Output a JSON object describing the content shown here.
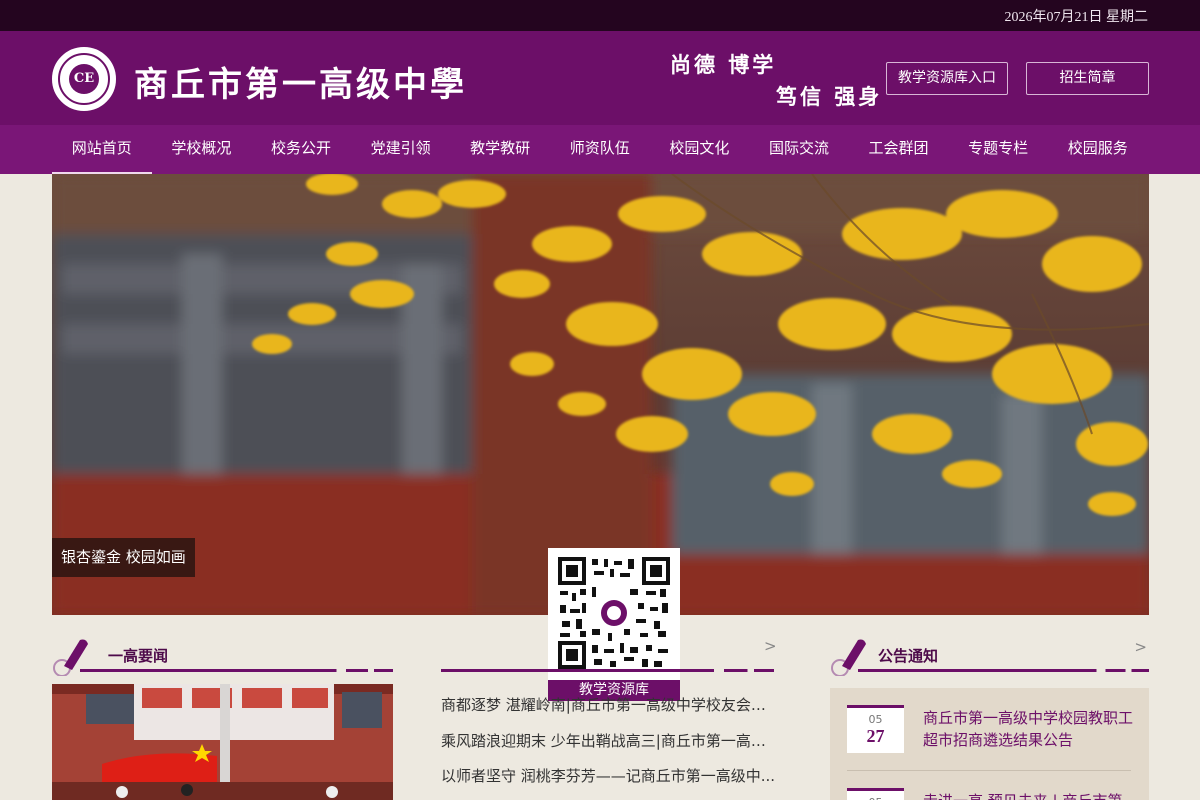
{
  "topbar": {
    "date": "2026年07月21日 星期二"
  },
  "header": {
    "school_name": "商丘市第一高级中學",
    "motto_line1": "尚德  博学",
    "motto_line2": "笃信  强身",
    "resource_button": "教学资源库入口",
    "admission_button": "招生简章"
  },
  "nav": {
    "items": [
      "网站首页",
      "学校概况",
      "校务公开",
      "党建引领",
      "教学教研",
      "师资队伍",
      "校园文化",
      "国际交流",
      "工会群团",
      "专题专栏",
      "校园服务"
    ],
    "active_index": 0
  },
  "banner": {
    "caption": "银杏鎏金 校园如画"
  },
  "qr": {
    "label": "教学资源库"
  },
  "sections": {
    "news": {
      "title": "一高要闻",
      "more": ">"
    },
    "middle": {
      "more": ">"
    },
    "notices": {
      "title": "公告通知",
      "more": ">"
    }
  },
  "middle_list": [
    "商都逐梦 湛耀岭南|商丘市第一高级中学校友会广...",
    "乘风踏浪迎期末 少年出鞘战高三|商丘市第一高级...",
    "以师者坚守 润桃李芬芳——记商丘市第一高级中..."
  ],
  "notices": [
    {
      "month": "05",
      "day": "27",
      "text": "商丘市第一高级中学校园教职工超市招商遴选结果公告"
    },
    {
      "month": "05",
      "day": "",
      "text": "走进一高 预见未来 | 商丘市第"
    }
  ],
  "colors": {
    "brand": "#6c0f68",
    "topbar": "#24051f",
    "nav": "#7a1677",
    "background": "#ede9e0"
  }
}
